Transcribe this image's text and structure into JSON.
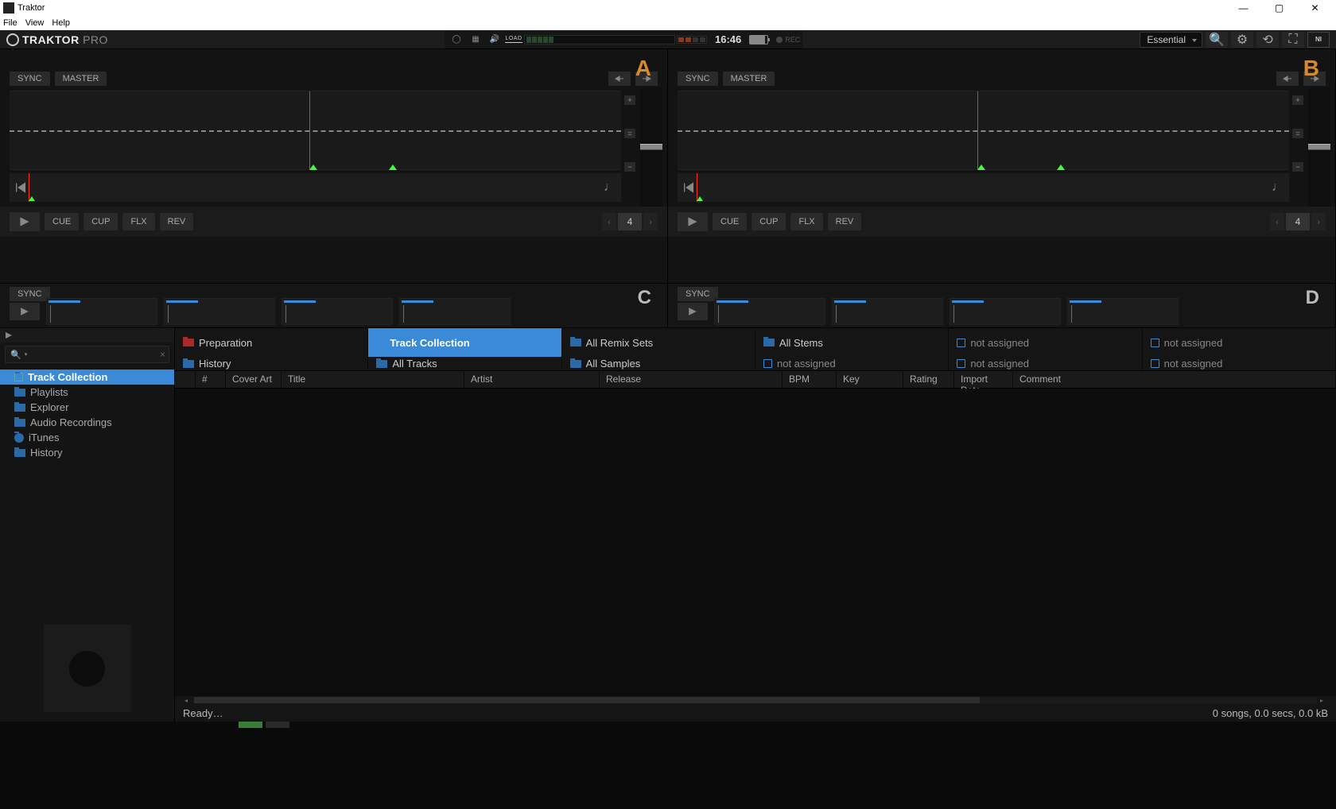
{
  "window": {
    "title": "Traktor"
  },
  "menu": {
    "file": "File",
    "view": "View",
    "help": "Help"
  },
  "header": {
    "brand": "TRAKTOR",
    "brand_suffix": "PRO",
    "load": "LOAD",
    "clock": "16:46",
    "rec": "REC",
    "layout": "Essential"
  },
  "deck_common": {
    "sync": "SYNC",
    "master": "MASTER",
    "cue": "CUE",
    "cup": "CUP",
    "flx": "FLX",
    "rev": "REV",
    "loop_size": "4"
  },
  "deck_a": {
    "letter": "A"
  },
  "deck_b": {
    "letter": "B"
  },
  "deck_c": {
    "letter": "C"
  },
  "deck_d": {
    "letter": "D"
  },
  "sidebar": {
    "items": [
      {
        "label": "Track Collection",
        "selected": true,
        "icon": "trackcol"
      },
      {
        "label": "Playlists",
        "icon": "folder"
      },
      {
        "label": "Explorer",
        "icon": "folder"
      },
      {
        "label": "Audio Recordings",
        "icon": "folder"
      },
      {
        "label": "iTunes",
        "icon": "itunes"
      },
      {
        "label": "History",
        "icon": "folder"
      }
    ]
  },
  "favorites_row1": [
    {
      "label": "Preparation",
      "icon": "red"
    },
    {
      "label": "Track Collection",
      "icon": "box",
      "selected": true
    },
    {
      "label": "All Remix Sets",
      "icon": "folder"
    },
    {
      "label": "All Stems",
      "icon": "folder"
    },
    {
      "label": "not assigned",
      "icon": "box",
      "na": true
    },
    {
      "label": "not assigned",
      "icon": "box",
      "na": true
    }
  ],
  "favorites_row2": [
    {
      "label": "History",
      "icon": "folder"
    },
    {
      "label": "All Tracks",
      "icon": "folder"
    },
    {
      "label": "All Samples",
      "icon": "folder"
    },
    {
      "label": "not assigned",
      "icon": "box",
      "na": true
    },
    {
      "label": "not assigned",
      "icon": "box",
      "na": true
    },
    {
      "label": "not assigned",
      "icon": "box",
      "na": true
    }
  ],
  "columns": {
    "num": "#",
    "cover": "Cover Art",
    "title": "Title",
    "artist": "Artist",
    "release": "Release",
    "bpm": "BPM",
    "key": "Key",
    "rating": "Rating",
    "import": "Import Date",
    "comment": "Comment"
  },
  "status": {
    "ready": "Ready…",
    "summary": "0 songs, 0.0 secs, 0.0 kB"
  }
}
